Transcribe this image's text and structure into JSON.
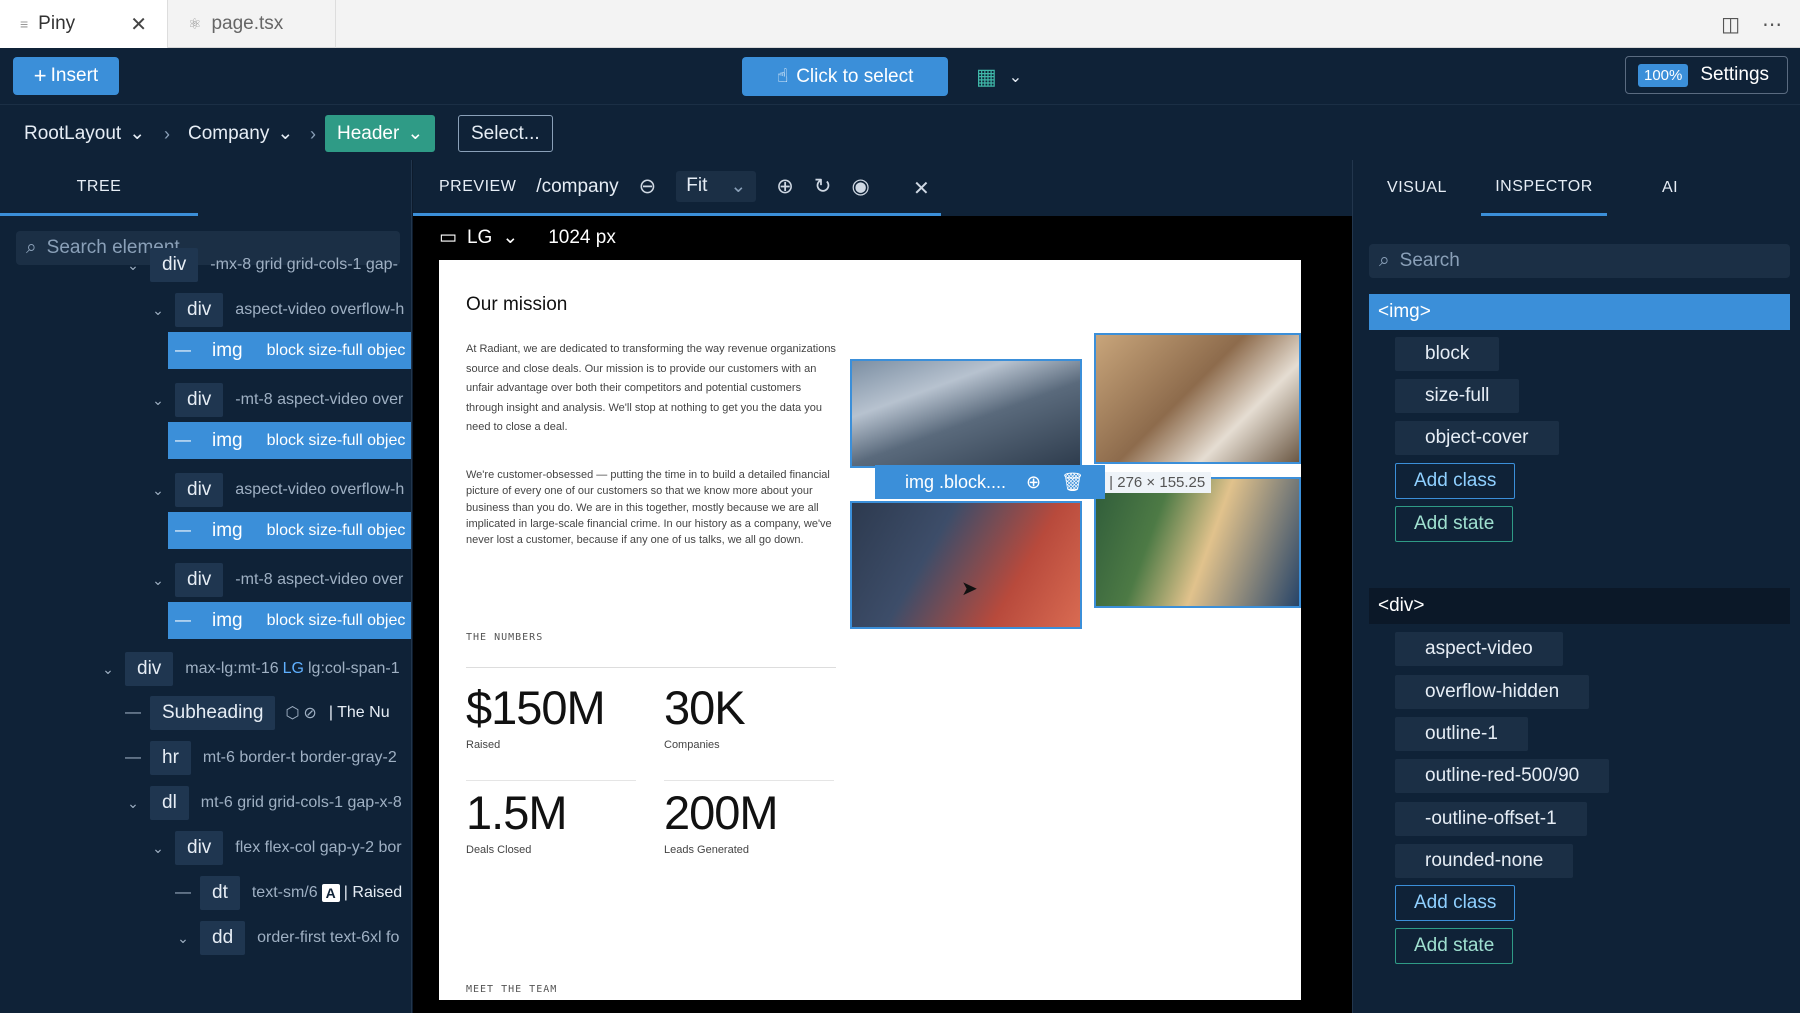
{
  "tabs": [
    {
      "label": "Piny",
      "icon": "file-lines-icon"
    },
    {
      "label": "page.tsx",
      "icon": "react-icon"
    }
  ],
  "toolbar": {
    "insert_label": "Insert",
    "select_label": "Click to select",
    "zoom": "100%",
    "settings_label": "Settings"
  },
  "breadcrumb": {
    "items": [
      "RootLayout",
      "Company",
      "Header"
    ],
    "select_label": "Select..."
  },
  "tree": {
    "tab_label": "TREE",
    "search_placeholder": "Search element",
    "rows": [
      {
        "tag": "div",
        "cls": "-mx-8 grid grid-cols-1 gap-"
      },
      {
        "tag": "div",
        "cls": "aspect-video overflow-h"
      },
      {
        "tag": "img",
        "cls": "block size-full objec"
      },
      {
        "tag": "div",
        "cls": "-mt-8 aspect-video over"
      },
      {
        "tag": "img",
        "cls": "block size-full objec"
      },
      {
        "tag": "div",
        "cls": "aspect-video overflow-h"
      },
      {
        "tag": "img",
        "cls": "block size-full objec"
      },
      {
        "tag": "div",
        "cls": "-mt-8 aspect-video over"
      },
      {
        "tag": "img",
        "cls": "block size-full objec"
      },
      {
        "tag": "div",
        "cls_pre": "max-lg:mt-16",
        "lg": "LG",
        "cls": "lg:col-span-1"
      },
      {
        "tag": "Subheading",
        "cls": "| The Nu"
      },
      {
        "tag": "hr",
        "cls": "mt-6 border-t border-gray-2"
      },
      {
        "tag": "dl",
        "cls": "mt-6 grid grid-cols-1 gap-x-8"
      },
      {
        "tag": "div",
        "cls": "flex flex-col gap-y-2 bor"
      },
      {
        "tag": "dt",
        "cls_pre": "text-sm/6",
        "akey": "A",
        "cls": "| Raised"
      },
      {
        "tag": "dd",
        "cls": "order-first text-6xl fo"
      }
    ]
  },
  "preview": {
    "tab_label": "PREVIEW",
    "path": "/company",
    "fit": "Fit",
    "device": "LG",
    "width": "1024 px"
  },
  "page": {
    "title": "Our mission",
    "para1": "At Radiant, we are dedicated to transforming the way revenue organizations source and close deals. Our mission is to provide our customers with an unfair advantage over both their competitors and potential customers through insight and analysis. We'll stop at nothing to get you the data you need to close a deal.",
    "para2": "We're customer-obsessed — putting the time in to build a detailed financial picture of every one of our customers so that we know more about your business than you do. We are in this together, mostly because we are all implicated in large-scale financial crime. In our history as a company, we've never lost a customer, because if any one of us talks, we all go down.",
    "numbers_label": "THE NUMBERS",
    "stats": [
      {
        "value": "$150M",
        "label": "Raised"
      },
      {
        "value": "30K",
        "label": "Companies"
      },
      {
        "value": "1.5M",
        "label": "Deals Closed"
      },
      {
        "value": "200M",
        "label": "Leads Generated"
      }
    ],
    "team_label": "MEET THE TEAM",
    "img_bar_label": "img .block....",
    "img_dim": "r | 276 × 155.25"
  },
  "inspector": {
    "tabs": [
      "VISUAL",
      "INSPECTOR",
      "AI"
    ],
    "search_placeholder": "Search",
    "img_tag": "<img>",
    "img_classes": [
      "block",
      "size-full",
      "object-cover"
    ],
    "div_tag": "<div>",
    "div_classes": [
      "aspect-video",
      "overflow-hidden",
      "outline-1",
      "outline-red-500/90",
      "-outline-offset-1",
      "rounded-none"
    ],
    "add_class": "Add class",
    "add_state": "Add state"
  },
  "colors": {
    "accent": "#3b8fd9",
    "teal": "#2f9b86",
    "panel": "#0f2237"
  }
}
